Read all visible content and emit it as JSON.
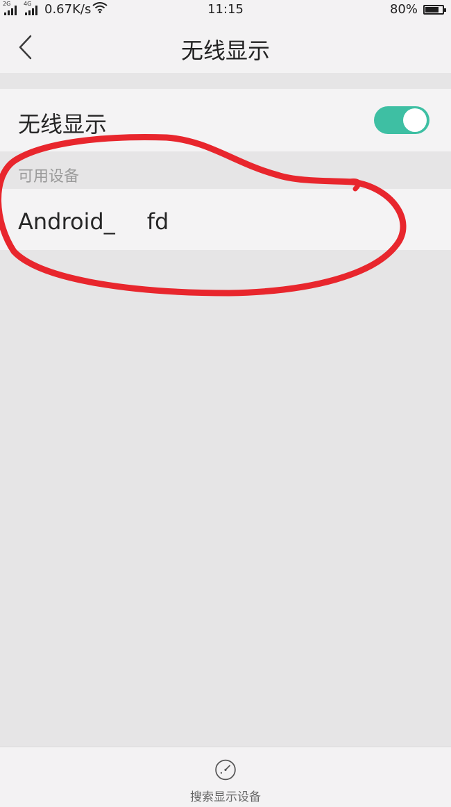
{
  "status_bar": {
    "network_tag_1": "2G",
    "network_tag_2": "4G",
    "speed": "0.67K/s",
    "time": "11:15",
    "battery_text": "80%",
    "battery_level": 0.8
  },
  "header": {
    "title": "无线显示"
  },
  "wireless_display": {
    "label": "无线显示",
    "enabled": true
  },
  "available_devices": {
    "header": "可用设备",
    "items": [
      {
        "name_start": "Android_",
        "name_end": "fd"
      }
    ]
  },
  "bottom_action": {
    "label": "搜索显示设备"
  },
  "colors": {
    "accent": "#3ebfa3",
    "annotation": "#e8262d"
  }
}
